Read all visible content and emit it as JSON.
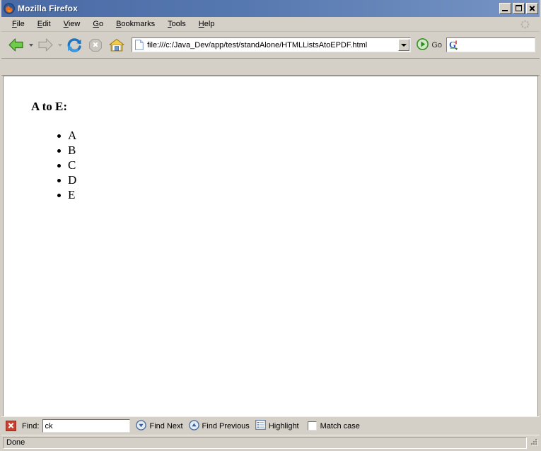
{
  "window": {
    "title": "Mozilla Firefox",
    "app_icon": "firefox-icon",
    "minimize_label": "Minimize",
    "maximize_label": "Maximize",
    "close_label": "Close"
  },
  "menubar": {
    "items": [
      {
        "label": "File",
        "accesskey": "F"
      },
      {
        "label": "Edit",
        "accesskey": "E"
      },
      {
        "label": "View",
        "accesskey": "V"
      },
      {
        "label": "Go",
        "accesskey": "G"
      },
      {
        "label": "Bookmarks",
        "accesskey": "B"
      },
      {
        "label": "Tools",
        "accesskey": "T"
      },
      {
        "label": "Help",
        "accesskey": "H"
      }
    ]
  },
  "toolbar": {
    "back": {
      "icon": "back-arrow-icon",
      "label": "Back",
      "enabled": true
    },
    "forward": {
      "icon": "forward-arrow-icon",
      "label": "Forward",
      "enabled": false
    },
    "reload": {
      "icon": "reload-icon",
      "label": "Reload",
      "enabled": true
    },
    "stop": {
      "icon": "stop-icon",
      "label": "Stop",
      "enabled": false
    },
    "home": {
      "icon": "home-icon",
      "label": "Home",
      "enabled": true
    },
    "url": {
      "icon": "page-document-icon",
      "value": "file:///c:/Java_Dev/app/test/standAlone/HTMLListsAtoEPDF.html",
      "placeholder": "",
      "dropdown_icon": "chevron-down-icon"
    },
    "go": {
      "icon": "go-play-icon",
      "label": "Go"
    },
    "search": {
      "icon": "google-g-icon",
      "value": "",
      "placeholder": ""
    }
  },
  "bookmarks_toolbar": {
    "items": []
  },
  "page": {
    "heading": "A to E:",
    "list_items": [
      "A",
      "B",
      "C",
      "D",
      "E"
    ]
  },
  "findbar": {
    "close_icon": "close-icon",
    "label": "Find:",
    "input_value": "ck",
    "input_placeholder": "",
    "find_next": {
      "icon": "arrow-down-circle-icon",
      "label": "Find Next"
    },
    "find_previous": {
      "icon": "arrow-up-circle-icon",
      "label": "Find Previous"
    },
    "highlight": {
      "icon": "highlight-icon",
      "label": "Highlight"
    },
    "match_case": {
      "label": "Match case",
      "checked": false
    }
  },
  "statusbar": {
    "text": "Done",
    "resize_grip_icon": "resize-grip-icon"
  },
  "colors": {
    "titlebar_start": "#4a6aa5",
    "titlebar_end": "#7794c4",
    "chrome": "#d4d0c8",
    "content_bg": "#ffffff",
    "close_red": "#c8402e",
    "go_green": "#3ea832"
  }
}
